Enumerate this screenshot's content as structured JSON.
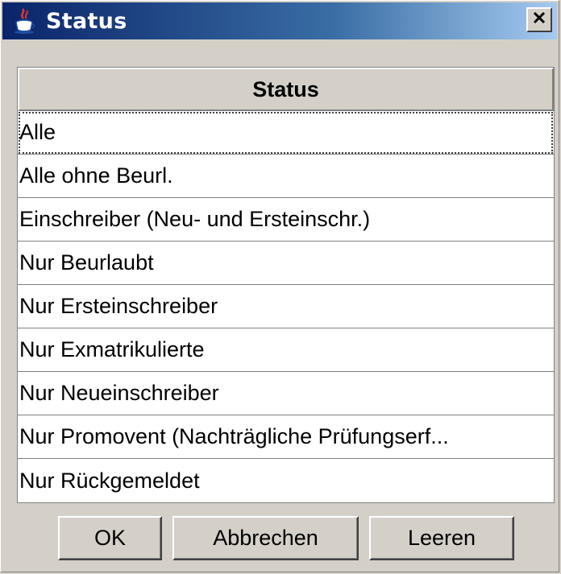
{
  "window": {
    "title": "Status"
  },
  "table": {
    "header": "Status",
    "rows": [
      "Alle",
      "Alle ohne Beurl.",
      "Einschreiber (Neu- und Ersteinschr.)",
      "Nur Beurlaubt",
      "Nur Ersteinschreiber",
      "Nur Exmatrikulierte",
      "Nur Neueinschreiber",
      "Nur Promovent (Nachträgliche Prüfungserf...",
      "Nur Rückgemeldet"
    ]
  },
  "buttons": {
    "ok": "OK",
    "cancel": "Abbrechen",
    "clear": "Leeren"
  },
  "icons": {
    "title": "java-coffee-cup-icon",
    "close": "close-icon"
  }
}
